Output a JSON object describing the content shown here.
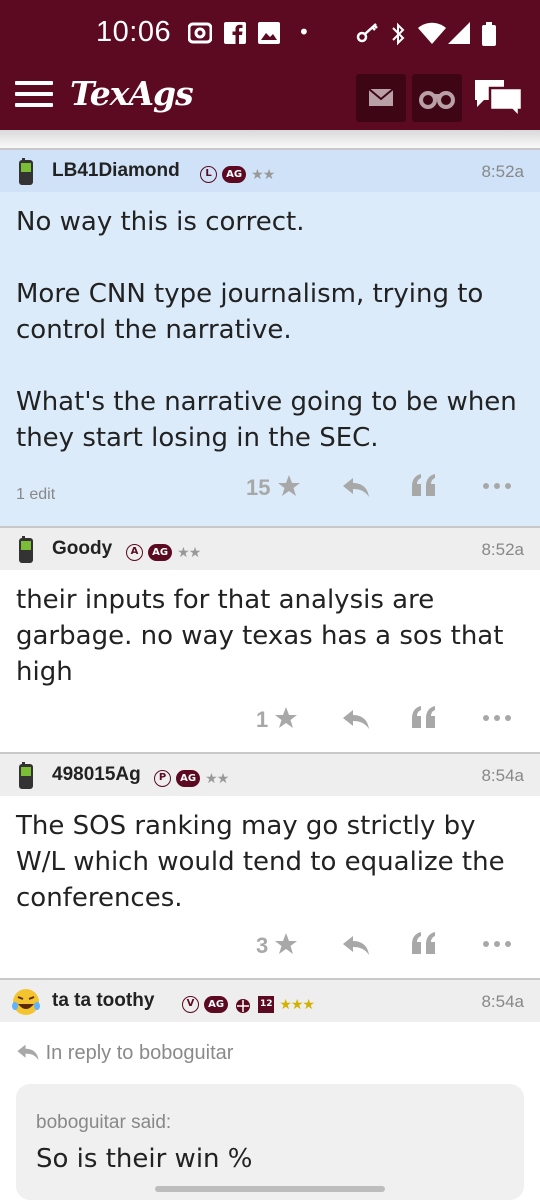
{
  "status": {
    "time": "10:06",
    "left_icons": [
      "camera-icon",
      "facebook-icon",
      "image-icon",
      "dot-icon"
    ],
    "right_icons": [
      "vpn-key-icon",
      "bluetooth-icon",
      "wifi-icon",
      "signal-icon",
      "battery-icon"
    ]
  },
  "header": {
    "logo": "TexAgs",
    "buttons": [
      "mail-icon",
      "binoculars-icon",
      "chat-icon"
    ]
  },
  "posts": [
    {
      "user": "LB41Diamond",
      "level": "L",
      "tag": "AG",
      "stars": "★★",
      "time": "8:52a",
      "body": [
        "No way this is correct.",
        "",
        "More CNN type journalism, trying to",
        "control the narrative.",
        "",
        "What's the narrative going to be when",
        "they start losing in the SEC."
      ],
      "edit": "1 edit",
      "star_count": "15",
      "bg": "#dcebfa",
      "head_bg": "#cfe2f7"
    },
    {
      "user": "Goody",
      "level": "A",
      "tag": "AG",
      "stars": "★★",
      "time": "8:52a",
      "body": [
        "their inputs for that analysis are",
        "garbage. no way texas has a sos that",
        "high"
      ],
      "star_count": "1",
      "bg": "#ffffff",
      "head_bg": "#eeeeee"
    },
    {
      "user": "498015Ag",
      "level": "P",
      "tag": "AG",
      "stars": "★★",
      "time": "8:54a",
      "body": [
        "The SOS ranking may go strictly by",
        "W/L which would tend to equalize the",
        "conferences."
      ],
      "star_count": "3",
      "bg": "#ffffff",
      "head_bg": "#eeeeee"
    },
    {
      "user": "ta ta toothy",
      "level": "V",
      "tag": "AG",
      "extra_badge": "12",
      "stars": "★★★",
      "time": "8:54a",
      "reply_label": "In reply to boboguitar",
      "quote_author": "boboguitar said:",
      "quote_text": "So is their win %",
      "bg": "#ffffff",
      "head_bg": "#eeeeee"
    }
  ],
  "actions": {
    "reply_icon": "reply-icon",
    "quote_icon": "quote-icon",
    "more_icon": "more-icon"
  }
}
